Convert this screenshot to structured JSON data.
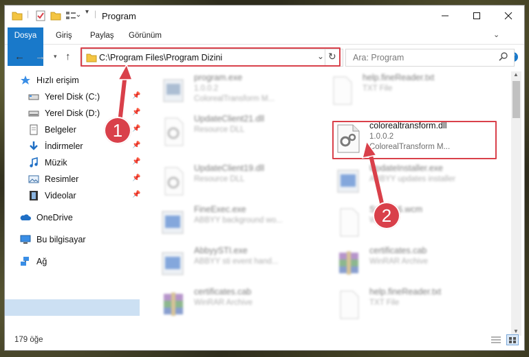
{
  "window": {
    "title": "Program"
  },
  "ribbon": {
    "tabs": [
      "Dosya",
      "Giriş",
      "Paylaş",
      "Görünüm"
    ]
  },
  "address": {
    "path": "C:\\Program Files\\Program Dizini"
  },
  "search": {
    "placeholder": "Ara: Program"
  },
  "sidebar": {
    "items": [
      {
        "label": "Hızlı erişim",
        "icon": "star-icon"
      },
      {
        "label": "Yerel Disk (C:)",
        "icon": "drive-icon"
      },
      {
        "label": "Yerel Disk (D:)",
        "icon": "drive-icon"
      },
      {
        "label": "Belgeler",
        "icon": "documents-icon"
      },
      {
        "label": "İndirmeler",
        "icon": "download-icon"
      },
      {
        "label": "Müzik",
        "icon": "music-icon"
      },
      {
        "label": "Resimler",
        "icon": "pictures-icon"
      },
      {
        "label": "Videolar",
        "icon": "videos-icon"
      },
      {
        "label": "OneDrive",
        "icon": "cloud-icon"
      },
      {
        "label": "Bu bilgisayar",
        "icon": "computer-icon"
      },
      {
        "label": "Ağ",
        "icon": "network-icon"
      }
    ]
  },
  "files": [
    {
      "name": "program.exe",
      "line1": "1.0.0.2",
      "line2": "ColorealTransform M..."
    },
    {
      "name": "help.fineReader.txt",
      "line1": "TXT File",
      "line2": ""
    },
    {
      "name": "UpdateClient21.dll",
      "line1": "Resource DLL",
      "line2": ""
    },
    {
      "name": "colorealtransform.dll",
      "line1": "1.0.0.2",
      "line2": "ColorealTransform M..."
    },
    {
      "name": "UpdateClient19.dll",
      "line1": "Resource DLL",
      "line2": ""
    },
    {
      "name": "UpdateInstaller.exe",
      "line1": "ABBYY updates installer",
      "line2": ""
    },
    {
      "name": "FineExec.exe",
      "line1": "ABBYY background wo...",
      "line2": ""
    },
    {
      "name": "Sn...P16.wcm",
      "line1": "W...",
      "line2": ""
    },
    {
      "name": "AbbyySTI.exe",
      "line1": "ABBYY sti event hand...",
      "line2": ""
    },
    {
      "name": "certificates.cab",
      "line1": "WinRAR Archive",
      "line2": ""
    },
    {
      "name": "certificates.cab",
      "line1": "WinRAR Archive",
      "line2": ""
    },
    {
      "name": "help.fineReader.txt",
      "line1": "TXT File",
      "line2": ""
    }
  ],
  "status": {
    "count": "179 öğe"
  },
  "annotations": {
    "step1": "1",
    "step2": "2"
  },
  "colors": {
    "accent": "#1979ca",
    "highlight": "#d9404a",
    "selection": "#cce0f3"
  }
}
